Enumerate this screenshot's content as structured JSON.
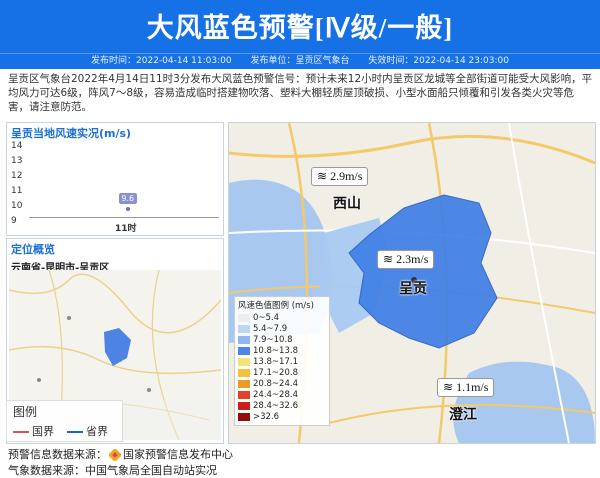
{
  "header": {
    "title": "大风蓝色预警[Ⅳ级/一般]",
    "publish_time": "发布时间：2022-04-14 11:03:00",
    "publisher": "发布单位：呈贡区气象台",
    "expire_time": "失效时间：2022-04-14 23:03:00"
  },
  "description": "呈贡区气象台2022年4月14日11时3分发布大风蓝色预警信号：预计未来12小时内呈贡区龙城等全部街道可能受大风影响，平均风力可达6级，阵风7～8级，容易造成临时搭建物吹落、塑料大棚轻质屋顶破损、小型水面船只倾覆和引发各类火灾等危害，请注意防范。",
  "wind_chart": {
    "title": "呈贡当地风速实况(m/s)",
    "point_label": "9.6",
    "x_label": "11时"
  },
  "chart_data": {
    "type": "line",
    "title": "呈贡当地风速实况(m/s)",
    "x": [
      "11时"
    ],
    "y": [
      9.6
    ],
    "yticks": [
      "14",
      "13",
      "12",
      "11",
      "10",
      "9"
    ],
    "ylim": [
      9,
      14
    ]
  },
  "location": {
    "title": "定位概览",
    "path": "云南省-昆明市-呈贡区",
    "legend_title": "图例",
    "legend_country": "国界",
    "legend_province": "省界",
    "colors": {
      "country": "#e05050",
      "province": "#1e5fd0"
    }
  },
  "map": {
    "tags": [
      {
        "value": "2.9m/s"
      },
      {
        "value": "2.3m/s"
      },
      {
        "value": "1.1m/s"
      }
    ],
    "cities": [
      "西山",
      "呈贡",
      "澄江"
    ],
    "legend_title": "风速色值图例 (m/s)",
    "legend": [
      {
        "label": "0~5.4",
        "color": "#eeeeee"
      },
      {
        "label": "5.4~7.9",
        "color": "#bcd6f3"
      },
      {
        "label": "7.9~10.8",
        "color": "#8fb8f0"
      },
      {
        "label": "10.8~13.8",
        "color": "#4c86ea"
      },
      {
        "label": "13.8~17.1",
        "color": "#f4e27a"
      },
      {
        "label": "17.1~20.8",
        "color": "#f3c23a"
      },
      {
        "label": "20.8~24.4",
        "color": "#ee9a2a"
      },
      {
        "label": "24.4~28.4",
        "color": "#e0422a"
      },
      {
        "label": "28.4~32.6",
        "color": "#c81f1f"
      },
      {
        "label": ">32.6",
        "color": "#8f0d0d"
      }
    ]
  },
  "footer": {
    "source1_prefix": "预警信息数据来源：",
    "source1_name": "国家预警信息发布中心",
    "source2": "气象数据来源：中国气象局全国自动站实况"
  }
}
